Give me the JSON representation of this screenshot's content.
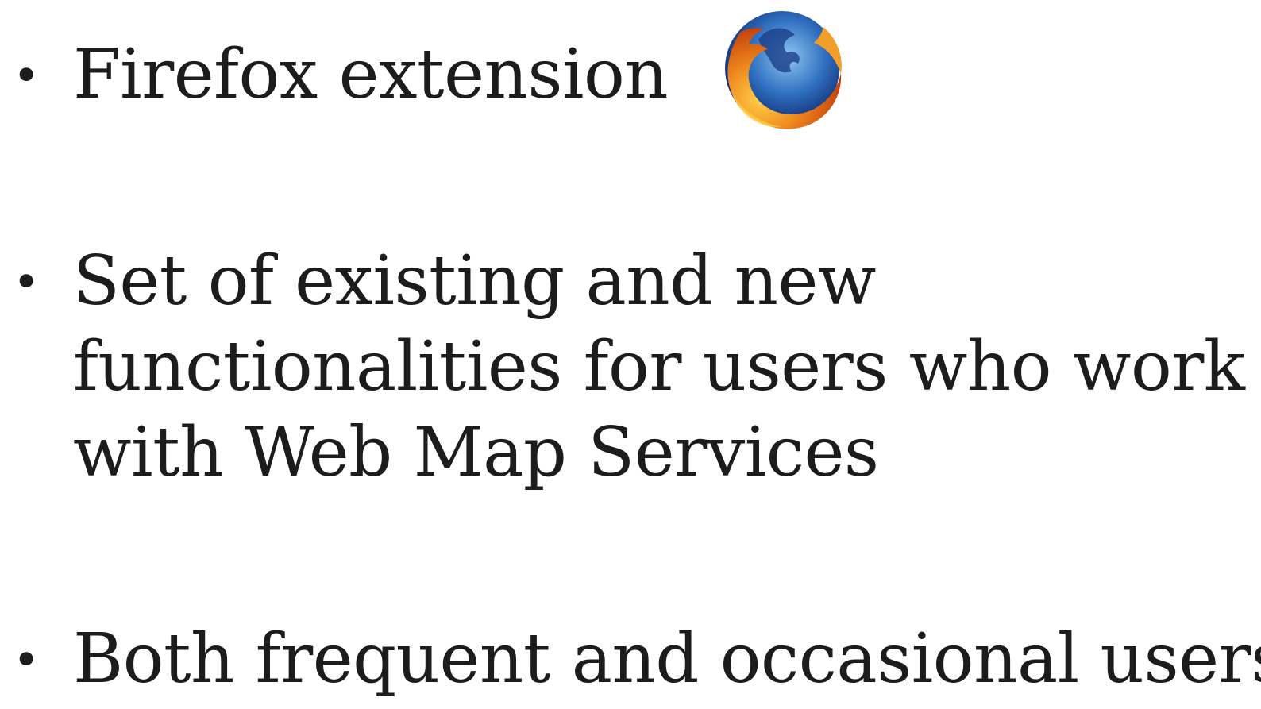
{
  "slide": {
    "bullet_symbol": "•",
    "items": [
      {
        "lines": [
          "Firefox extension"
        ]
      },
      {
        "lines": [
          "Set of existing and new",
          "functionalities for users who work",
          "with Web Map Services"
        ]
      },
      {
        "lines": [
          "Both frequent and occasional users"
        ]
      }
    ],
    "logo_icon": "firefox-logo-icon",
    "colors": {
      "text": "#1c1c1c",
      "background": "#ffffff",
      "fox_orange": "#e8781c",
      "globe_blue": "#2a64b4"
    }
  }
}
